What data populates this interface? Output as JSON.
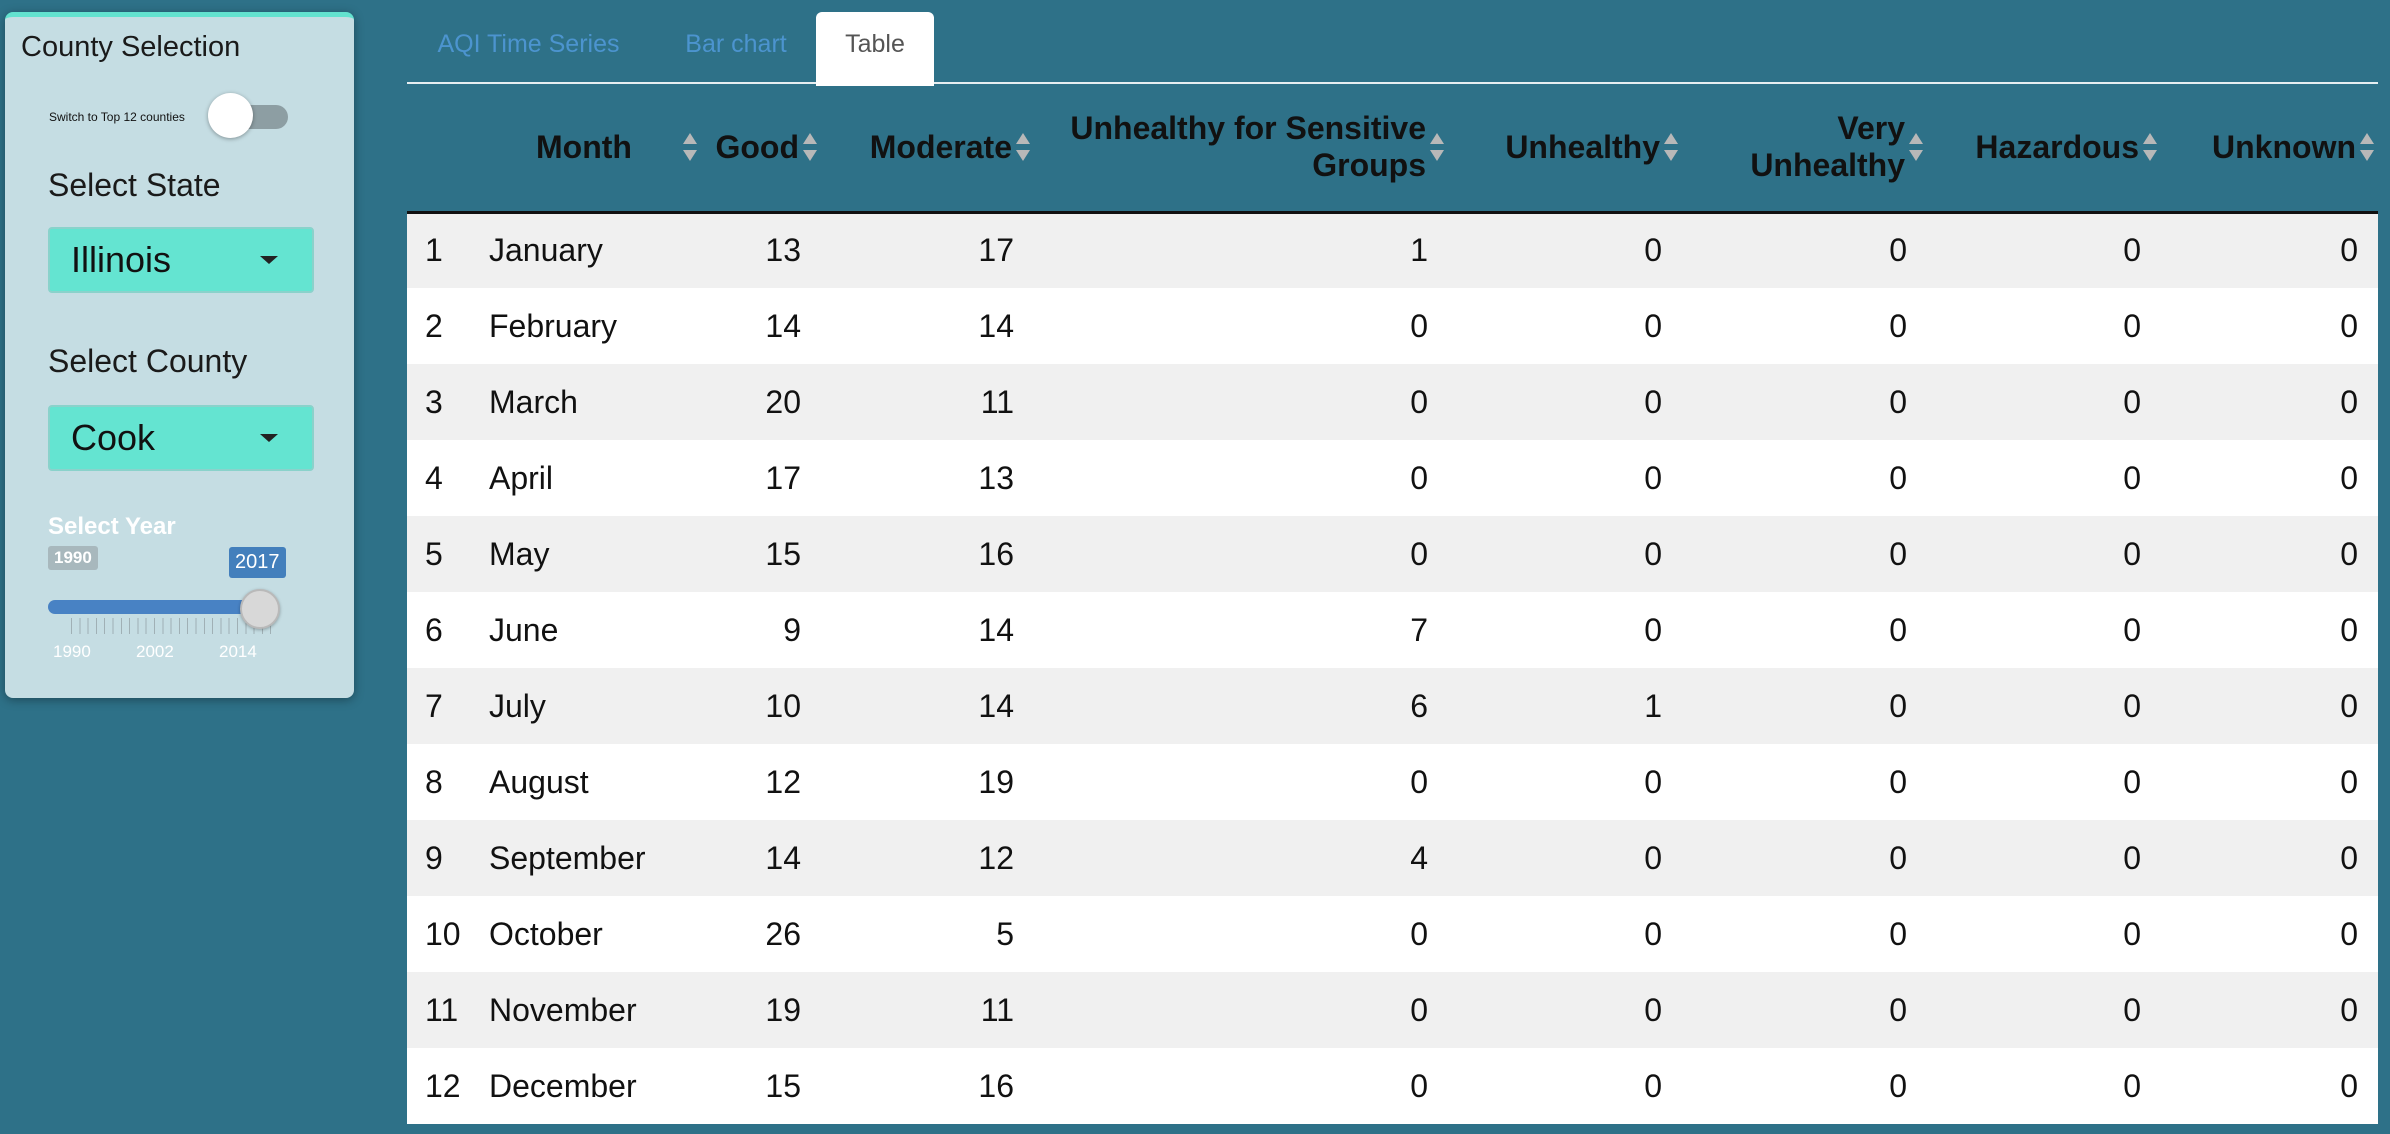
{
  "sidebar": {
    "title": "County Selection",
    "toggle_label": "Switch to Top 12 counties",
    "toggle_on": false,
    "state_label": "Select State",
    "state_value": "Illinois",
    "county_label": "Select County",
    "county_value": "Cook",
    "year_label": "Select Year",
    "year_min": "1990",
    "year_value": "2017",
    "year_max_fraction": 1.0,
    "tick_labels": [
      "1990",
      "2002",
      "2014"
    ]
  },
  "tabs": [
    {
      "label": "AQI Time Series",
      "active": false
    },
    {
      "label": "Bar chart",
      "active": false
    },
    {
      "label": "Table",
      "active": true
    }
  ],
  "table": {
    "headers": {
      "index": "",
      "month": "Month",
      "good": "Good",
      "moderate": "Moderate",
      "usg": "Unhealthy for Sensitive Groups",
      "unhealthy": "Unhealthy",
      "very_unhealthy": "Very Unhealthy",
      "hazardous": "Hazardous",
      "unknown": "Unknown"
    },
    "rows": [
      {
        "i": "1",
        "month": "January",
        "good": "13",
        "moderate": "17",
        "usg": "1",
        "unhealthy": "0",
        "very_unhealthy": "0",
        "hazardous": "0",
        "unknown": "0"
      },
      {
        "i": "2",
        "month": "February",
        "good": "14",
        "moderate": "14",
        "usg": "0",
        "unhealthy": "0",
        "very_unhealthy": "0",
        "hazardous": "0",
        "unknown": "0"
      },
      {
        "i": "3",
        "month": "March",
        "good": "20",
        "moderate": "11",
        "usg": "0",
        "unhealthy": "0",
        "very_unhealthy": "0",
        "hazardous": "0",
        "unknown": "0"
      },
      {
        "i": "4",
        "month": "April",
        "good": "17",
        "moderate": "13",
        "usg": "0",
        "unhealthy": "0",
        "very_unhealthy": "0",
        "hazardous": "0",
        "unknown": "0"
      },
      {
        "i": "5",
        "month": "May",
        "good": "15",
        "moderate": "16",
        "usg": "0",
        "unhealthy": "0",
        "very_unhealthy": "0",
        "hazardous": "0",
        "unknown": "0"
      },
      {
        "i": "6",
        "month": "June",
        "good": "9",
        "moderate": "14",
        "usg": "7",
        "unhealthy": "0",
        "very_unhealthy": "0",
        "hazardous": "0",
        "unknown": "0"
      },
      {
        "i": "7",
        "month": "July",
        "good": "10",
        "moderate": "14",
        "usg": "6",
        "unhealthy": "1",
        "very_unhealthy": "0",
        "hazardous": "0",
        "unknown": "0"
      },
      {
        "i": "8",
        "month": "August",
        "good": "12",
        "moderate": "19",
        "usg": "0",
        "unhealthy": "0",
        "very_unhealthy": "0",
        "hazardous": "0",
        "unknown": "0"
      },
      {
        "i": "9",
        "month": "September",
        "good": "14",
        "moderate": "12",
        "usg": "4",
        "unhealthy": "0",
        "very_unhealthy": "0",
        "hazardous": "0",
        "unknown": "0"
      },
      {
        "i": "10",
        "month": "October",
        "good": "26",
        "moderate": "5",
        "usg": "0",
        "unhealthy": "0",
        "very_unhealthy": "0",
        "hazardous": "0",
        "unknown": "0"
      },
      {
        "i": "11",
        "month": "November",
        "good": "19",
        "moderate": "11",
        "usg": "0",
        "unhealthy": "0",
        "very_unhealthy": "0",
        "hazardous": "0",
        "unknown": "0"
      },
      {
        "i": "12",
        "month": "December",
        "good": "15",
        "moderate": "16",
        "usg": "0",
        "unhealthy": "0",
        "very_unhealthy": "0",
        "hazardous": "0",
        "unknown": "0"
      }
    ]
  },
  "colors": {
    "page_bg": "#2e7188",
    "sidebar_bg": "#c5dde3",
    "select_bg": "#64e4d1",
    "slider_accent": "#4882c4",
    "tab_link": "#4c94cf",
    "row_stripe": "#f0f0f0"
  },
  "icons": {
    "select_caret": "caret-down-icon",
    "sort": "sort-arrows-icon",
    "slider_thumb": "slider-handle"
  }
}
